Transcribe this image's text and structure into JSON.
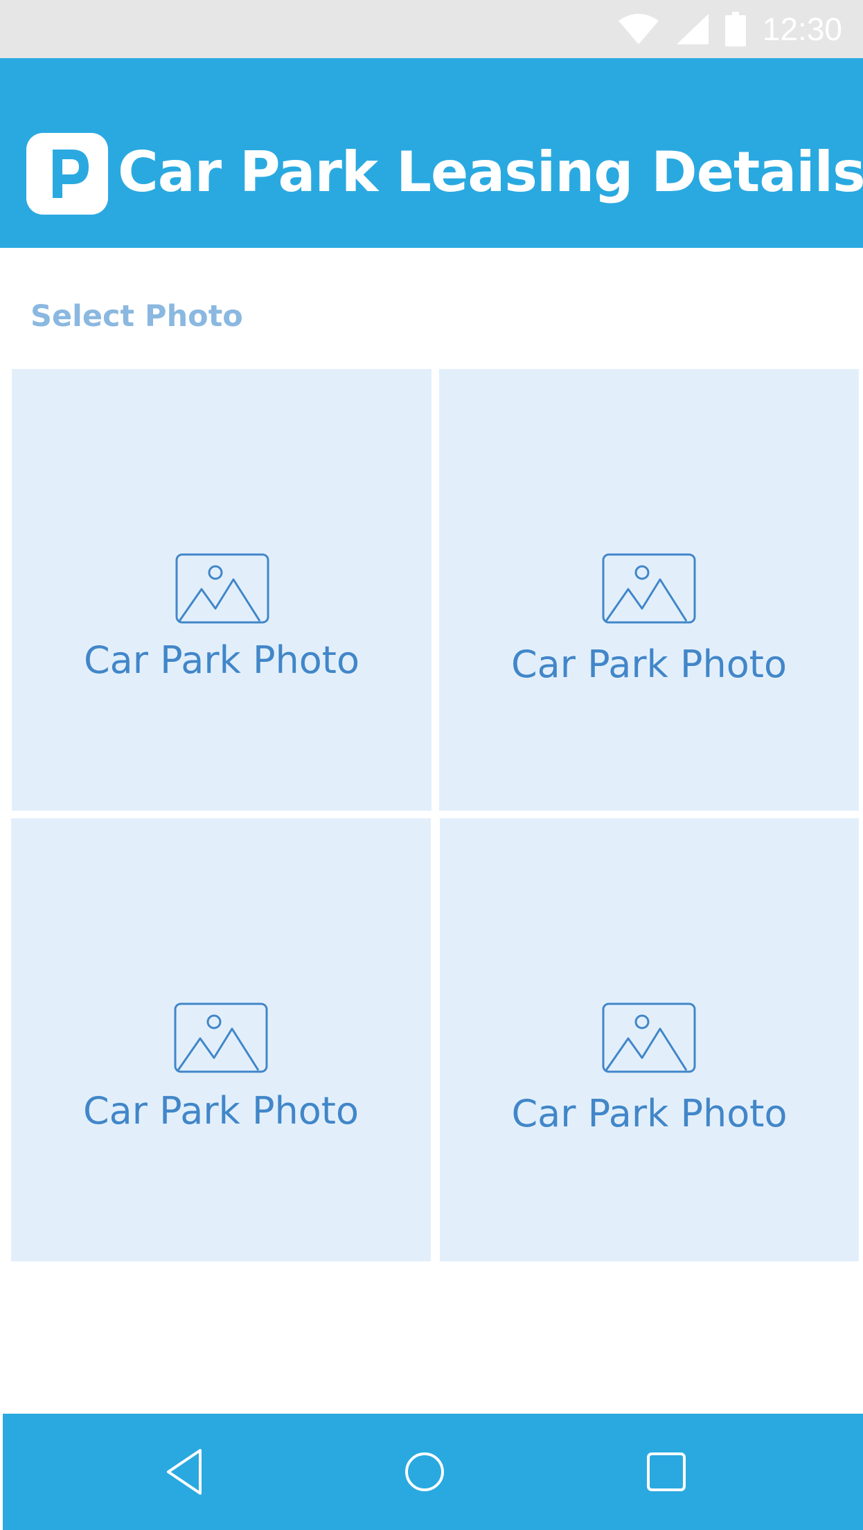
{
  "status_bar": {
    "time": "12:30",
    "icons": [
      "wifi-icon",
      "cell-signal-icon",
      "battery-icon"
    ]
  },
  "app_bar": {
    "title": "Car Park Leasing Details",
    "logo_icon": "parking-logo-icon"
  },
  "section": {
    "label": "Select Photo"
  },
  "photos": [
    {
      "label": "Car Park Photo",
      "icon": "image-placeholder-icon"
    },
    {
      "label": "Car Park Photo",
      "icon": "image-placeholder-icon"
    },
    {
      "label": "Car Park Photo",
      "icon": "image-placeholder-icon"
    },
    {
      "label": "Car Park Photo",
      "icon": "image-placeholder-icon"
    }
  ],
  "nav_bar": {
    "buttons": [
      "back-icon",
      "home-icon",
      "recents-icon"
    ]
  },
  "colors": {
    "primary": "#2aa9e0",
    "tile_background": "#e2effb",
    "tile_text": "#4186c8",
    "section_label": "#8ab8e0",
    "status_bar": "#e6e6e6"
  }
}
